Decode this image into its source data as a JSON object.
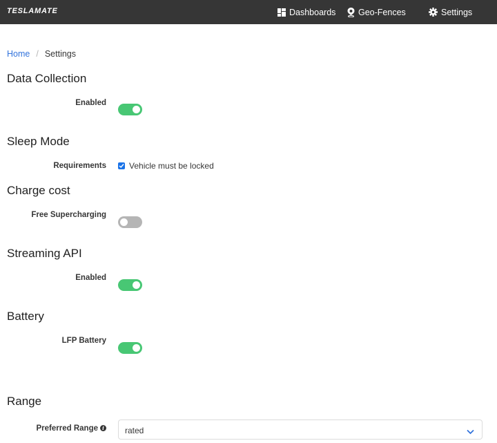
{
  "navbar": {
    "brand": "TESLAMATE",
    "items": [
      {
        "label": "Dashboards",
        "icon": "dashboard-icon"
      },
      {
        "label": "Geo-Fences",
        "icon": "map-marker-icon"
      },
      {
        "label": "Settings",
        "icon": "gear-icon"
      }
    ]
  },
  "breadcrumb": {
    "home": "Home",
    "separator": "/",
    "current": "Settings"
  },
  "sections": {
    "data_collection": {
      "title": "Data Collection",
      "label": "Enabled",
      "enabled": true
    },
    "sleep_mode": {
      "title": "Sleep Mode",
      "label": "Requirements",
      "checkbox_label": "Vehicle must be locked",
      "checked": true
    },
    "charge_cost": {
      "title": "Charge cost",
      "label": "Free Supercharging",
      "enabled": false
    },
    "streaming_api": {
      "title": "Streaming API",
      "label": "Enabled",
      "enabled": true
    },
    "battery": {
      "title": "Battery",
      "label": "LFP Battery",
      "enabled": true
    },
    "range": {
      "title": "Range",
      "label": "Preferred Range",
      "selected": "rated"
    }
  },
  "colors": {
    "navbar": "#363636",
    "link": "#3273dc",
    "toggle_on": "#48c774",
    "toggle_off": "#b5b5b5",
    "checkbox": "#1a73e8"
  }
}
